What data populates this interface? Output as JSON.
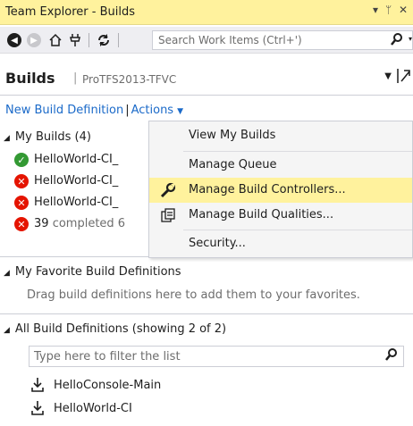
{
  "window": {
    "title": "Team Explorer - Builds",
    "dropdown_glyph": "▾",
    "pin_glyph": "ᛘ",
    "close_glyph": "✕"
  },
  "toolbar": {
    "search_placeholder": "Search Work Items (Ctrl+')",
    "icons": [
      "back-icon",
      "forward-icon",
      "home-icon",
      "connect-icon",
      "refresh-icon",
      "search-icon"
    ]
  },
  "page": {
    "title": "Builds",
    "server": "ProTFS2013-TFVC"
  },
  "actions_bar": {
    "new_build_definition": "New Build Definition",
    "actions": "Actions"
  },
  "my_builds": {
    "header": "My Builds (4)",
    "items": [
      {
        "status": "succeeded",
        "name": "HelloWorld-CI_"
      },
      {
        "status": "failed",
        "name": "HelloWorld-CI_"
      },
      {
        "status": "failed",
        "name": "HelloWorld-CI_"
      },
      {
        "status": "failed",
        "count": "39",
        "suffix": "completed 6"
      }
    ]
  },
  "actions_menu": {
    "items": [
      {
        "label": "View My Builds",
        "icon": ""
      },
      {
        "label": "Manage Queue",
        "icon": ""
      },
      {
        "label": "Manage Build Controllers...",
        "icon": "wrench-icon",
        "highlighted": true
      },
      {
        "label": "Manage Build Qualities...",
        "icon": "qualities-icon"
      },
      {
        "label": "Security...",
        "icon": ""
      }
    ]
  },
  "favorites": {
    "header": "My Favorite Build Definitions",
    "hint": "Drag build definitions here to add them to your favorites."
  },
  "all_definitions": {
    "header": "All Build Definitions (showing 2 of 2)",
    "filter_placeholder": "Type here to filter the list",
    "items": [
      "HelloConsole-Main",
      "HelloWorld-CI"
    ]
  },
  "colors": {
    "title_bar": "#fff29d",
    "link": "#1b6ac9",
    "success": "#339933",
    "failure": "#e51400",
    "menu_highlight": "#fff29d"
  }
}
